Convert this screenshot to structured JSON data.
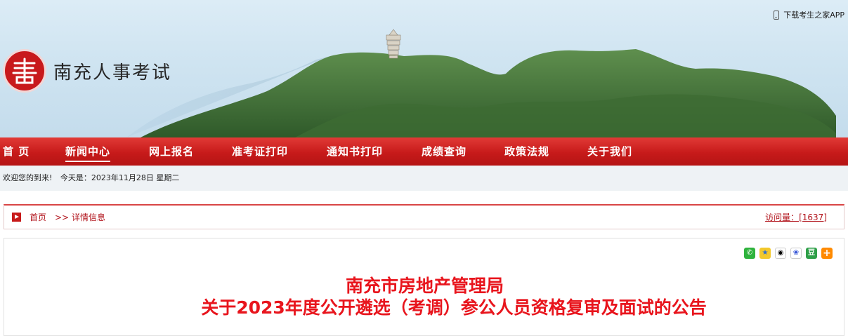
{
  "header": {
    "app_link": "下载考生之家APP",
    "site_title": "南充人事考试",
    "logo_glyph": "书"
  },
  "nav": {
    "items": [
      {
        "label": "首 页",
        "active": false
      },
      {
        "label": "新闻中心",
        "active": true
      },
      {
        "label": "网上报名",
        "active": false
      },
      {
        "label": "准考证打印",
        "active": false
      },
      {
        "label": "通知书打印",
        "active": false
      },
      {
        "label": "成绩查询",
        "active": false
      },
      {
        "label": "政策法规",
        "active": false
      },
      {
        "label": "关于我们",
        "active": false
      }
    ]
  },
  "welcome": {
    "greeting": "欢迎您的到来!",
    "today": "今天是：2023年11月28日 星期二"
  },
  "breadcrumb": {
    "home": "首页",
    "separator": ">>",
    "current": "详情信息",
    "visits": "访问量：[1637]"
  },
  "article": {
    "title_line1": "南充市房地产管理局",
    "title_line2": "关于2023年度公开遴选（考调）参公人员资格复审及面试的公告"
  },
  "share_icons": [
    "wechat-icon",
    "qzone-icon",
    "qq-icon",
    "baidu-icon",
    "douban-icon",
    "more-icon"
  ],
  "colors": {
    "nav_red": "#c71a1a",
    "title_red": "#e8151d",
    "crumb_red": "#b2141c"
  }
}
